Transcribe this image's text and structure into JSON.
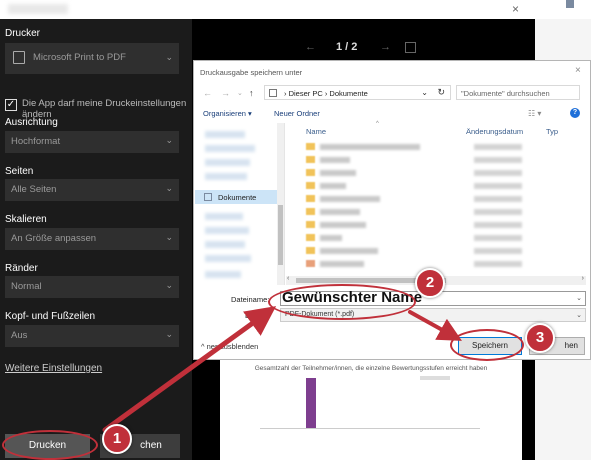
{
  "window": {
    "close_glyph": "×"
  },
  "print_panel": {
    "printer_label": "Drucker",
    "printer_value": "Microsoft Print to PDF",
    "app_settings_checkbox": "Die App darf meine Druckeinstellungen ändern",
    "orientation_label": "Ausrichtung",
    "orientation_value": "Hochformat",
    "pages_label": "Seiten",
    "pages_value": "Alle Seiten",
    "scale_label": "Skalieren",
    "scale_value": "An Größe anpassen",
    "margins_label": "Ränder",
    "margins_value": "Normal",
    "header_footer_label": "Kopf- und Fußzeilen",
    "header_footer_value": "Aus",
    "more_settings": "Weitere Einstellungen",
    "print_button": "Drucken",
    "cancel_button_partial": "chen"
  },
  "preview": {
    "page_indicator": "1 / 2",
    "chart_subtitle": "Gesamtzahl der Teilnehmer/innen, die einzelne Bewertungsstufen erreicht haben"
  },
  "save_dialog": {
    "title": "Druckausgabe speichern unter",
    "breadcrumb": "›  Dieser PC  ›  Dokumente",
    "search_placeholder": "\"Dokumente\" durchsuchen",
    "organize": "Organisieren ▾",
    "new_folder": "Neuer Ordner",
    "help": "?",
    "tree_selected": "Dokumente",
    "columns": {
      "name": "Name",
      "date": "Änderungsdatum",
      "type": "Typ"
    },
    "filename_label": "Dateiname:",
    "filename_value": "Gewünschter Name",
    "filetype_label": "Dateityp:",
    "filetype_label_visible": "Dat",
    "filetype_value": "PDF-Dokument (*.pdf)",
    "hide_folders": "Ordner ausblenden",
    "hide_folders_visible": "ner ausblenden",
    "save_button": "Speichern",
    "cancel_button_partial": "hen"
  },
  "annotations": {
    "step1": "1",
    "step2": "2",
    "step3": "3",
    "color": "#c0303a"
  }
}
